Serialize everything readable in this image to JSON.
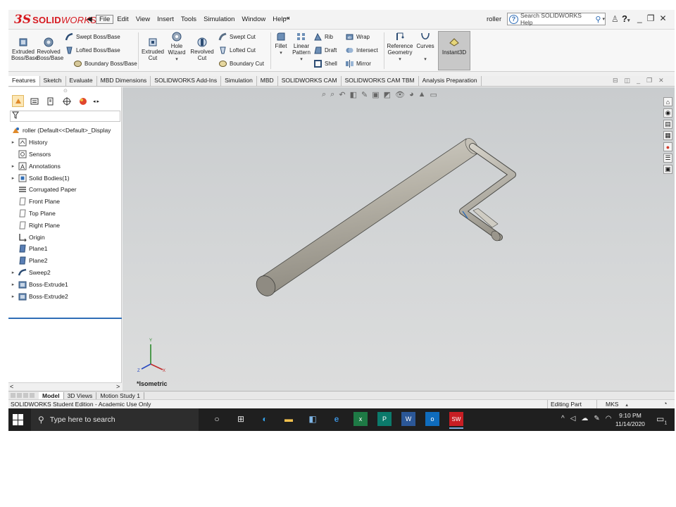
{
  "app": {
    "brand_prefix": "SOLID",
    "brand_suffix": "WORKS",
    "document_name": "roller"
  },
  "menu": [
    "File",
    "Edit",
    "View",
    "Insert",
    "Tools",
    "Simulation",
    "Window",
    "Help"
  ],
  "help_search": {
    "placeholder": "Search SOLIDWORKS Help"
  },
  "toolbar": {
    "extruded_boss": [
      "Extruded",
      "Boss/Base"
    ],
    "revolved_boss": [
      "Revolved",
      "Boss/Base"
    ],
    "swept_boss": "Swept Boss/Base",
    "lofted_boss": "Lofted Boss/Base",
    "boundary_boss": "Boundary Boss/Base",
    "extruded_cut": [
      "Extruded",
      "Cut"
    ],
    "hole_wizard": [
      "Hole",
      "Wizard"
    ],
    "revolved_cut": [
      "Revolved",
      "Cut"
    ],
    "swept_cut": "Swept Cut",
    "lofted_cut": "Lofted Cut",
    "boundary_cut": "Boundary Cut",
    "fillet": "Fillet",
    "linear_pattern": [
      "Linear",
      "Pattern"
    ],
    "rib": "Rib",
    "draft": "Draft",
    "shell": "Shell",
    "wrap": "Wrap",
    "intersect": "Intersect",
    "mirror": "Mirror",
    "reference_geometry": [
      "Reference",
      "Geometry"
    ],
    "curves": "Curves",
    "instant3d": "Instant3D"
  },
  "tabs": [
    "Features",
    "Sketch",
    "Evaluate",
    "MBD Dimensions",
    "SOLIDWORKS Add-Ins",
    "Simulation",
    "MBD",
    "SOLIDWORKS CAM",
    "SOLIDWORKS CAM TBM",
    "Analysis Preparation"
  ],
  "active_tab": "Features",
  "tree": {
    "root": "roller  (Default<<Default>_Display",
    "items": [
      {
        "label": "History",
        "expandable": true,
        "icon": "history-icon"
      },
      {
        "label": "Sensors",
        "expandable": false,
        "icon": "sensor-icon"
      },
      {
        "label": "Annotations",
        "expandable": true,
        "icon": "annotation-icon"
      },
      {
        "label": "Solid Bodies(1)",
        "expandable": true,
        "icon": "solid-body-icon"
      },
      {
        "label": "Corrugated Paper",
        "expandable": false,
        "icon": "material-icon"
      },
      {
        "label": "Front Plane",
        "expandable": false,
        "icon": "plane-icon"
      },
      {
        "label": "Top Plane",
        "expandable": false,
        "icon": "plane-icon"
      },
      {
        "label": "Right Plane",
        "expandable": false,
        "icon": "plane-icon"
      },
      {
        "label": "Origin",
        "expandable": false,
        "icon": "origin-icon"
      },
      {
        "label": "Plane1",
        "expandable": false,
        "icon": "ref-plane-icon"
      },
      {
        "label": "Plane2",
        "expandable": false,
        "icon": "ref-plane-icon"
      },
      {
        "label": "Sweep2",
        "expandable": true,
        "icon": "sweep-icon"
      },
      {
        "label": "Boss-Extrude1",
        "expandable": true,
        "icon": "extrude-icon"
      },
      {
        "label": "Boss-Extrude2",
        "expandable": true,
        "icon": "extrude-icon"
      }
    ]
  },
  "viewport": {
    "view_name": "*Isometric"
  },
  "model_tabs": [
    "Model",
    "3D Views",
    "Motion Study 1"
  ],
  "active_model_tab": "Model",
  "status": {
    "left": "SOLIDWORKS Student Edition - Academic Use Only",
    "mode": "Editing Part",
    "units": "MKS"
  },
  "taskbar": {
    "search_placeholder": "Type here to search",
    "time": "9:10 PM",
    "date": "11/14/2020",
    "notification_count": "1"
  },
  "colors": {
    "brand_red": "#d6181f",
    "selection_blue": "#2f6db6",
    "model_gray": "#b7b3a8"
  }
}
